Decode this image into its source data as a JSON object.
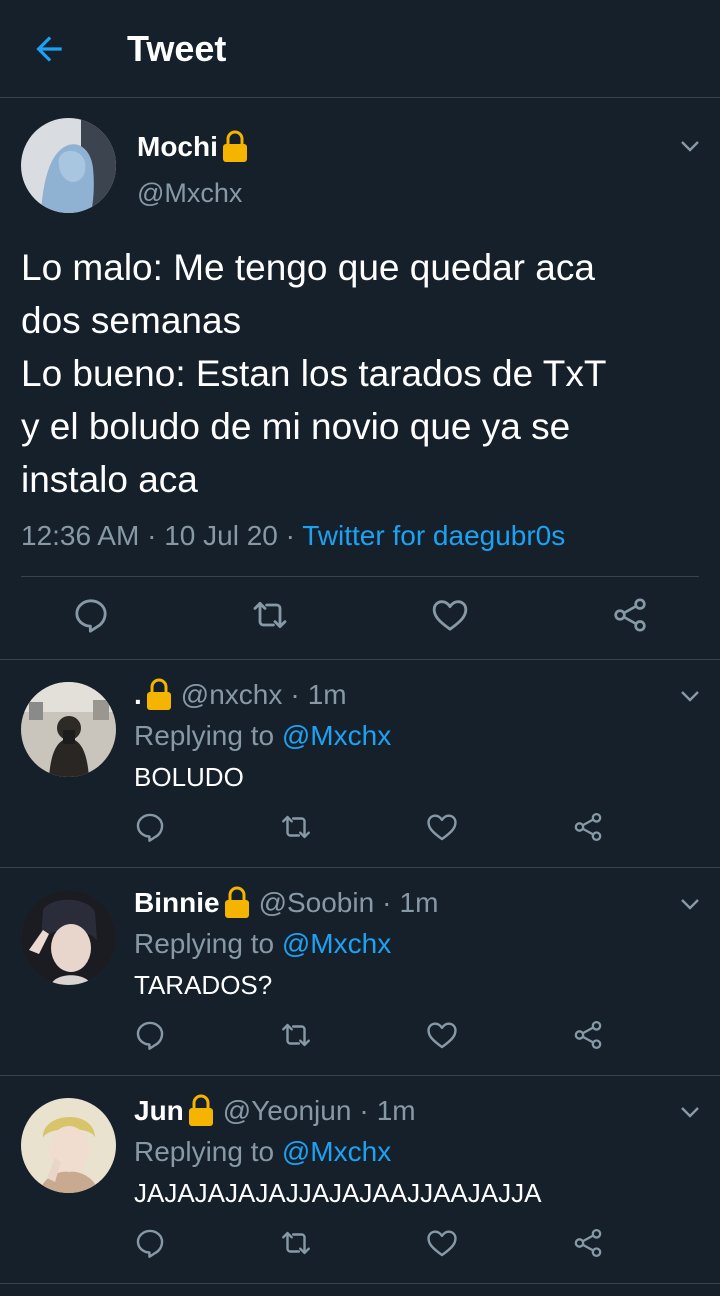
{
  "header": {
    "title": "Tweet",
    "back_icon": "arrow-left-icon"
  },
  "colors": {
    "background": "#15202b",
    "divider": "#38444d",
    "secondary_text": "#8899a6",
    "accent": "#1da1f2",
    "lock": "#f5b400"
  },
  "main_tweet": {
    "name": "Mochi",
    "handle": "@Mxchx",
    "text": "Lo malo: Me tengo que quedar aca\ndos semanas\nLo bueno: Estan los tarados de TxT\ny el boludo de mi novio que ya se\ninstalo aca",
    "time": "12:36 AM",
    "date": "10 Jul 20",
    "source": "Twitter for daegubr0s"
  },
  "replies": [
    {
      "name": ".",
      "handle": "@nxchx",
      "age": "1m",
      "replying_label": "Replying to",
      "mention": "@Mxchx",
      "text": "BOLUDO"
    },
    {
      "name": "Binnie",
      "handle": "@Soobin",
      "age": "1m",
      "replying_label": "Replying to",
      "mention": "@Mxchx",
      "text": "TARADOS?"
    },
    {
      "name": "Jun",
      "handle": "@Yeonjun",
      "age": "1m",
      "replying_label": "Replying to",
      "mention": "@Mxchx",
      "text": "JAJAJAJAJAJJAJAJAAJJAAJAJJA"
    }
  ],
  "separator": "·",
  "actions": [
    "reply-icon",
    "retweet-icon",
    "like-icon",
    "share-icon"
  ]
}
